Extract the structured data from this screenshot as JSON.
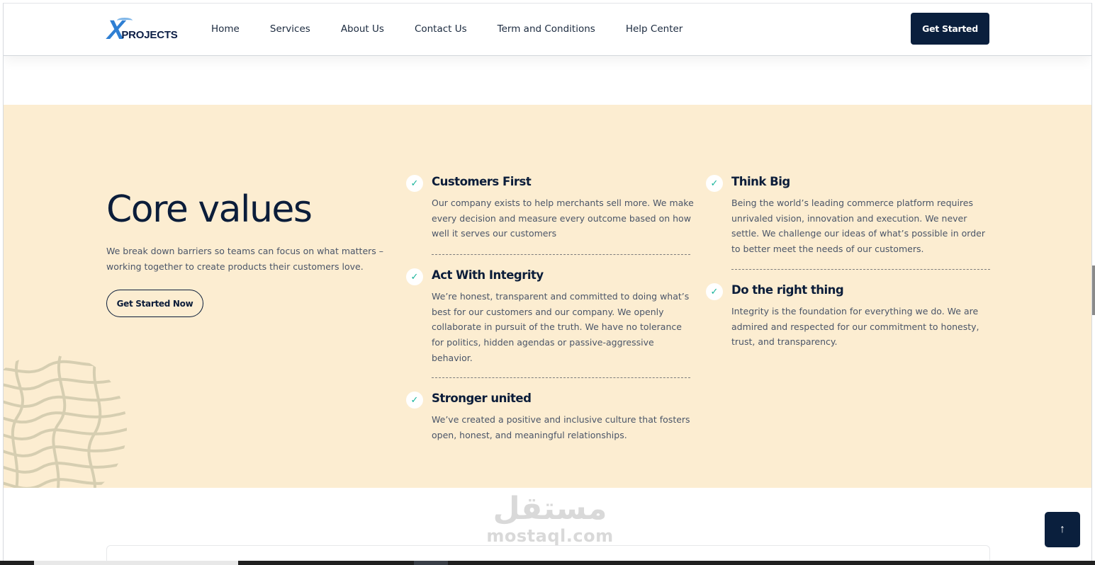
{
  "header": {
    "logo_text": "PROJECTS",
    "logo_mark": "X",
    "nav": [
      "Home",
      "Services",
      "About Us",
      "Contact Us",
      "Term and Conditions",
      "Help Center"
    ],
    "cta_label": "Get Started"
  },
  "core": {
    "title": "Core values",
    "subtitle": "We break down barriers so teams can focus on what matters – working together to create products their customers love.",
    "cta_label": "Get Started Now",
    "values": [
      {
        "title": "Customers First",
        "text": "Our company exists to help merchants sell more. We make every decision and measure every outcome based on how well it serves our customers"
      },
      {
        "title": "Act With Integrity",
        "text": "We’re honest, transparent and committed to doing what’s best for our customers and our company. We openly collaborate in pursuit of the truth. We have no tolerance for politics, hidden agendas or passive-aggressive behavior."
      },
      {
        "title": "Stronger united",
        "text": "We’ve created a positive and inclusive culture that fosters open, honest, and meaningful relationships."
      },
      {
        "title": "Think Big",
        "text": "Being the world’s leading commerce platform requires unrivaled vision, innovation and execution. We never settle. We challenge our ideas of what’s possible in order to better meet the needs of our customers."
      },
      {
        "title": "Do the right thing",
        "text": "Integrity is the foundation for everything we do. We are admired and respected for our commitment to honesty, trust, and transparency."
      }
    ],
    "check_icon": "✓",
    "check_color": "#16b39a",
    "background": "#fcedd1"
  },
  "watermark": {
    "arabic": "مستقل",
    "latin": "mostaql.com"
  },
  "scroll_top_icon": "↑",
  "colors": {
    "navy": "#0a1f3d",
    "accent_blue": "#2f7fd3"
  }
}
